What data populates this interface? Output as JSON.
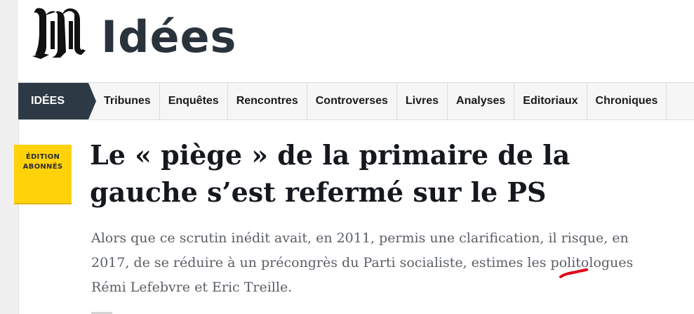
{
  "header": {
    "logo": "M",
    "title": "Idées"
  },
  "nav": {
    "active": "IDÉES",
    "items": [
      "Tribunes",
      "Enquêtes",
      "Rencontres",
      "Controverses",
      "Livres",
      "Analyses",
      "Editoriaux",
      "Chroniques"
    ]
  },
  "badge": {
    "line1": "ÉDITION",
    "line2": "ABONNÉS",
    "color": "#ffd20a"
  },
  "article": {
    "headline": "Le « piège » de la primaire de la gauche s’est refermé sur le PS",
    "standfirst": "Alors que ce scrutin inédit avait, en 2011, permis une clarification, il risque, en 2017, de se réduire à un précongrès du Parti socialiste, estimes les politologues Rémi Lefebvre et Eric Treille."
  },
  "colors": {
    "nav_active_bg": "#2d3a45",
    "title": "#2a323b",
    "spellcheck": "#e3001b"
  }
}
